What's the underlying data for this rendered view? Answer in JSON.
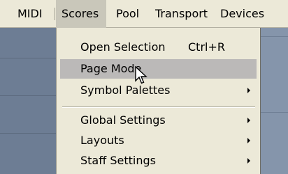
{
  "menubar": {
    "items": [
      {
        "label": "MIDI"
      },
      {
        "label": "Scores"
      },
      {
        "label": "Pool"
      },
      {
        "label": "Transport"
      },
      {
        "label": "Devices"
      }
    ],
    "active": "Scores"
  },
  "dropdown": {
    "items": [
      {
        "label": "Open Selection",
        "shortcut": "Ctrl+R"
      },
      {
        "label": "Page Mode",
        "highlighted": true
      },
      {
        "label": "Symbol Palettes",
        "submenu": true
      },
      {
        "label": "Global Settings",
        "submenu": true
      },
      {
        "label": "Layouts",
        "submenu": true
      },
      {
        "label": "Staff Settings",
        "submenu": true
      }
    ]
  },
  "colors": {
    "menu_background": "#ece9d8",
    "highlight": "#bbb9b8",
    "workspace": "#6e7e94"
  },
  "icons": [
    "submenu-arrow-icon",
    "mouse-pointer-icon"
  ]
}
